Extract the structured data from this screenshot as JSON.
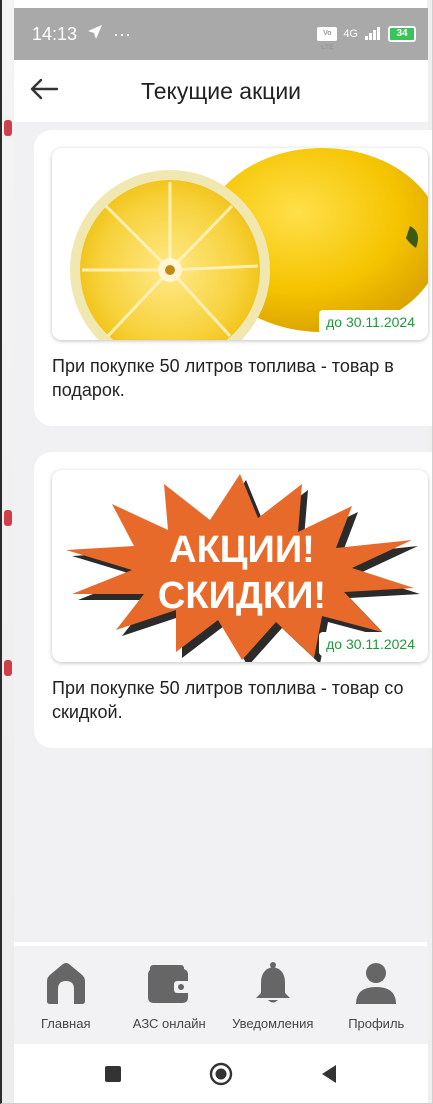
{
  "status_bar": {
    "time": "14:13",
    "left_icons": [
      "navigation-arrow-icon",
      "more-dots-icon"
    ],
    "more": "···",
    "volte": "Vo LTE",
    "network": "4G",
    "battery": "34"
  },
  "header": {
    "title": "Текущие акции",
    "back_icon": "arrow-left-icon"
  },
  "promotions": [
    {
      "image": "lemon-photo",
      "badge": "до 30.11.2024",
      "text": "При покупке 50 литров топлива - товар в подарок."
    },
    {
      "image": "promo-burst-banner",
      "banner_line1": "АКЦИИ!",
      "banner_line2": "СКИДКИ!",
      "badge": "до 30.11.2024",
      "text": "При покупке 50 литров топлива - товар со скидкой."
    }
  ],
  "bottom_nav": {
    "items": [
      {
        "label": "Главная",
        "icon": "home-icon"
      },
      {
        "label": "АЗС онлайн",
        "icon": "wallet-icon"
      },
      {
        "label": "Уведомления",
        "icon": "bell-icon"
      },
      {
        "label": "Профиль",
        "icon": "user-icon"
      }
    ]
  },
  "system_nav": [
    "recents-square-icon",
    "home-circle-icon",
    "back-triangle-icon"
  ],
  "colors": {
    "status_bar_bg": "#a9a9a9",
    "date_badge_text": "#1e9a3a",
    "content_bg": "#f1f1f4",
    "nav_icon": "#666666",
    "burst_orange": "#e86a2a",
    "lemon_yellow": "#f5c400"
  }
}
